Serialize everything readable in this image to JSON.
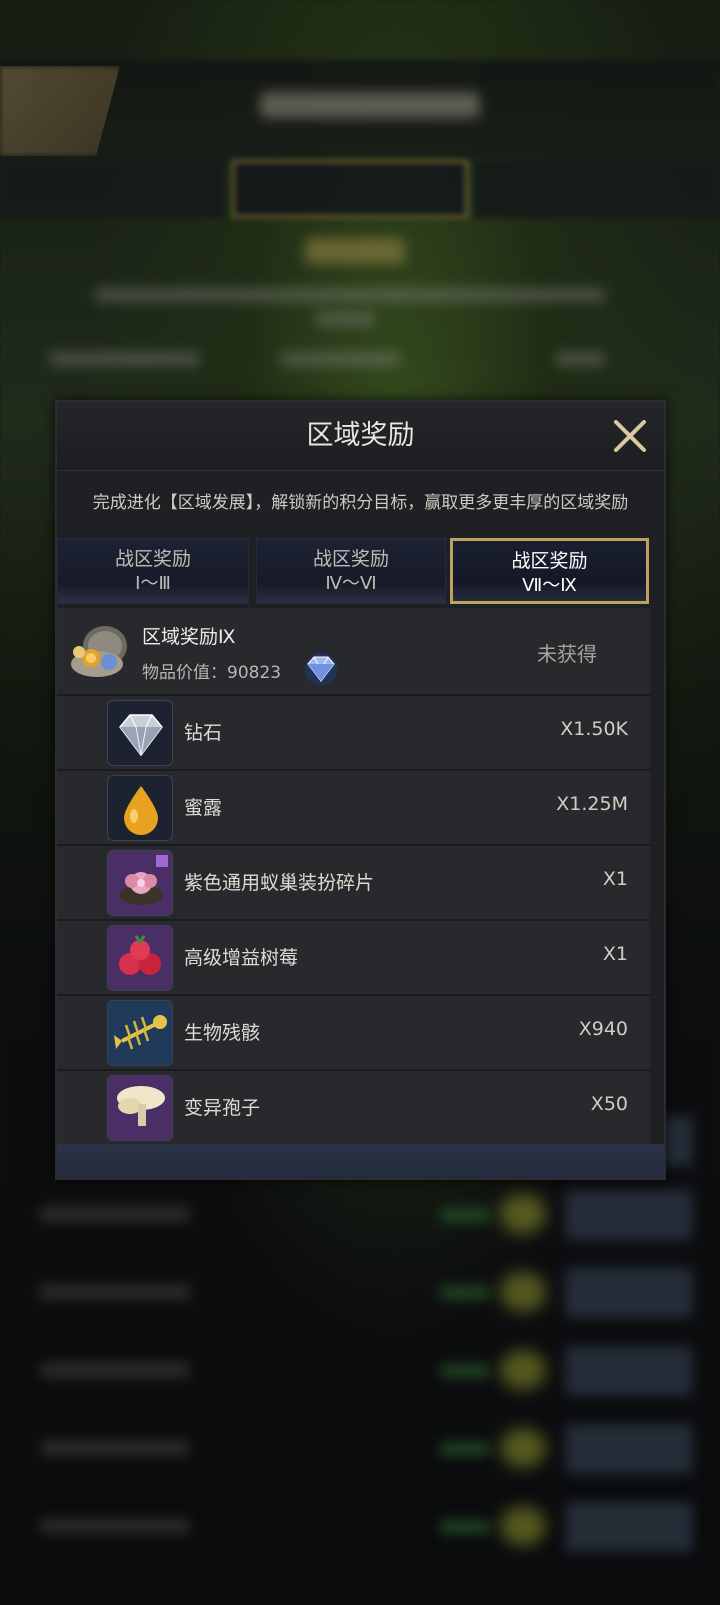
{
  "modal": {
    "title": "区域奖励",
    "description": "完成进化【区域发展】，解锁新的积分目标，赢取更多更丰厚的区域奖励",
    "tabs": [
      {
        "line1": "战区奖励",
        "line2": "Ⅰ～Ⅲ",
        "selected": false
      },
      {
        "line1": "战区奖励",
        "line2": "Ⅳ～Ⅵ",
        "selected": false
      },
      {
        "line1": "战区奖励",
        "line2": "Ⅶ～Ⅸ",
        "selected": true
      }
    ],
    "summary": {
      "title": "区域奖励Ⅸ",
      "value_label": "物品价值：90823",
      "status": "未获得"
    },
    "items": [
      {
        "name": "钻石",
        "qty": "X1.50K",
        "icon": "diamond-icon"
      },
      {
        "name": "蜜露",
        "qty": "X1.25M",
        "icon": "honeydew-drop-icon"
      },
      {
        "name": "紫色通用蚁巢装扮碎片",
        "qty": "X1",
        "icon": "nest-decoration-fragment-icon"
      },
      {
        "name": "高级增益树莓",
        "qty": "X1",
        "icon": "raspberry-icon"
      },
      {
        "name": "生物残骸",
        "qty": "X940",
        "icon": "fish-skeleton-icon"
      },
      {
        "name": "变异孢子",
        "qty": "X50",
        "icon": "spore-mushroom-icon"
      }
    ]
  },
  "colors": {
    "selected_tab_border": "#bca160",
    "panel_bg": "#1f2023",
    "row_bg": "#28292c"
  }
}
